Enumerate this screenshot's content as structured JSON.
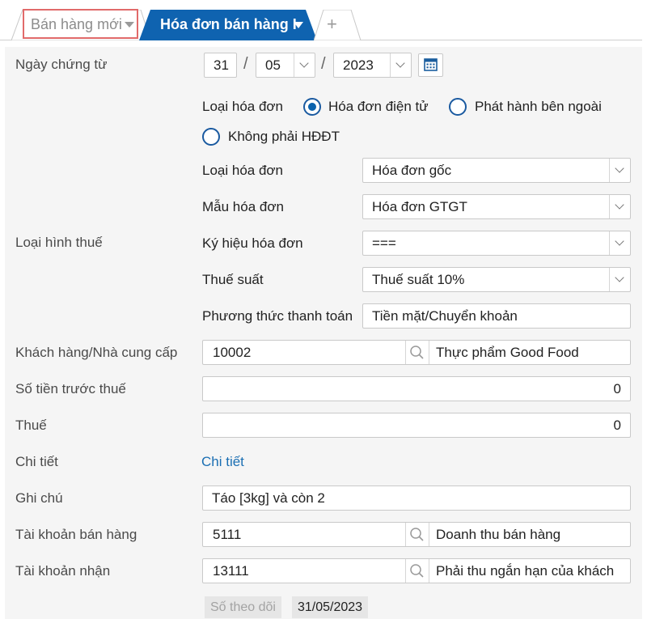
{
  "tabs": {
    "new_sale": "Bán hàng mới",
    "sales_invoice": "Hóa đơn bán hàng I",
    "add": "+"
  },
  "form": {
    "date": {
      "label": "Ngày chứng từ",
      "day": "31",
      "month": "05",
      "year": "2023",
      "sep": "/"
    },
    "tax_type": {
      "label": "Loại hình thuế",
      "invoice_kind_label": "Loại hóa đơn",
      "radios": [
        {
          "label": "Hóa đơn điện tử",
          "checked": true
        },
        {
          "label": "Phát hành bên ngoài",
          "checked": false
        },
        {
          "label": "Không phải HĐĐT",
          "checked": false
        }
      ],
      "invoice_type_label": "Loại hóa đơn",
      "invoice_type_value": "Hóa đơn gốc",
      "template_label": "Mẫu hóa đơn",
      "template_value": "Hóa đơn GTGT",
      "symbol_label": "Ký hiệu hóa đơn",
      "symbol_value": "===",
      "rate_label": "Thuế suất",
      "rate_value": "Thuế suất 10%",
      "payment_label": "Phương thức thanh toán",
      "payment_value": "Tiền mặt/Chuyển khoản"
    },
    "customer": {
      "label": "Khách hàng/Nhà cung cấp",
      "code": "10002",
      "name": "Thực phẩm Good Food"
    },
    "pre_tax": {
      "label": "Số tiền trước thuế",
      "value": "0"
    },
    "tax": {
      "label": "Thuế",
      "value": "0"
    },
    "detail": {
      "label": "Chi tiết",
      "link": "Chi tiết"
    },
    "note": {
      "label": "Ghi chú",
      "value": "Táo [3kg] và còn 2"
    },
    "sales_account": {
      "label": "Tài khoản bán hàng",
      "code": "5111",
      "name": "Doanh thu bán hàng"
    },
    "receive_account": {
      "label": "Tài khoản nhận",
      "code": "13111",
      "name": "Phải thu ngắn hạn của khách"
    },
    "tracking": {
      "label": "Số theo dõi",
      "value": "31/05/2023"
    }
  },
  "colors": {
    "active_tab": "#0f63b0",
    "highlight_border": "#e16a6a",
    "radio": "#0b62ad",
    "link": "#1b6fb3"
  }
}
